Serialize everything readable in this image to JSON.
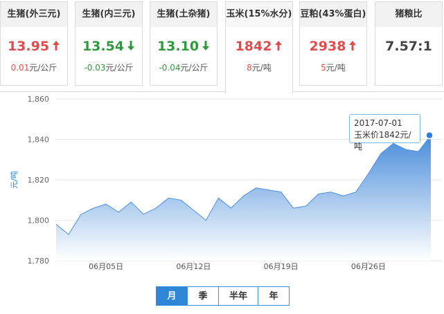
{
  "cards": [
    {
      "title": "生猪(外三元)",
      "value": "13.95",
      "change": "0.01",
      "unit": "元/公斤",
      "trend": "up"
    },
    {
      "title": "生猪(内三元)",
      "value": "13.54",
      "change": "-0.03",
      "unit": "元/公斤",
      "trend": "down"
    },
    {
      "title": "生猪(土杂猪)",
      "value": "13.10",
      "change": "-0.04",
      "unit": "元/公斤",
      "trend": "down"
    },
    {
      "title": "玉米(15%水分)",
      "value": "1842",
      "change": "8",
      "unit": "元/吨",
      "trend": "up"
    },
    {
      "title": "豆粕(43%蛋白)",
      "value": "2938",
      "change": "5",
      "unit": "元/吨",
      "trend": "up"
    },
    {
      "title": "猪粮比",
      "value": "7.57:1",
      "change": "",
      "unit": "",
      "trend": "none"
    }
  ],
  "colors": {
    "up": "#e24b4b",
    "down": "#2f9a3c",
    "accent": "#2d86d6",
    "area_top": "#4a90e2",
    "area_bottom": "#ffffff"
  },
  "tooltip": {
    "date": "2017-07-01",
    "text": "玉米价1842元/吨"
  },
  "tabs": [
    {
      "label": "月",
      "active": true
    },
    {
      "label": "季",
      "active": false
    },
    {
      "label": "半年",
      "active": false
    },
    {
      "label": "年",
      "active": false
    }
  ],
  "chart_data": {
    "type": "area",
    "ylabel": "元/吨",
    "ylim": [
      1780,
      1860
    ],
    "yticks": [
      1780,
      1800,
      1820,
      1840,
      1860
    ],
    "ytick_labels": [
      "1,780",
      "1,800",
      "1,820",
      "1,840",
      "1,860"
    ],
    "xtick_labels": [
      "06月05日",
      "06月12日",
      "06月19日",
      "06月26日"
    ],
    "grid": true,
    "series": [
      {
        "x": [
          "06-01",
          "06-02",
          "06-03",
          "06-04",
          "06-05",
          "06-06",
          "06-07",
          "06-08",
          "06-09",
          "06-10",
          "06-11",
          "06-12",
          "06-13",
          "06-14",
          "06-15",
          "06-16",
          "06-17",
          "06-18",
          "06-19",
          "06-20",
          "06-21",
          "06-22",
          "06-23",
          "06-24",
          "06-25",
          "06-26",
          "06-27",
          "06-28",
          "06-29",
          "06-30",
          "07-01"
        ],
        "values": [
          1798,
          1793,
          1803,
          1806,
          1808,
          1804,
          1809,
          1803,
          1806,
          1811,
          1810,
          1805,
          1800,
          1811,
          1806,
          1812,
          1816,
          1815,
          1814,
          1806,
          1807,
          1813,
          1814,
          1812,
          1814,
          1823,
          1833,
          1838,
          1835,
          1834,
          1842
        ]
      }
    ]
  }
}
